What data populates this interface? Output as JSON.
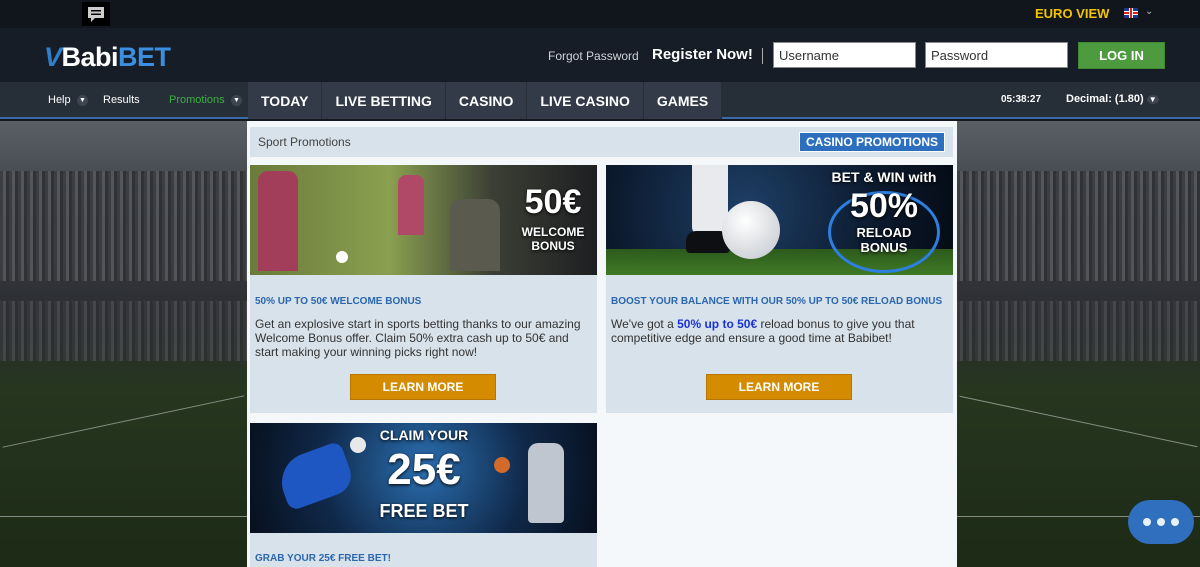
{
  "topbar": {
    "region": "EURO VIEW"
  },
  "header": {
    "logo_prefix": "Babi",
    "logo_suffix": "BET",
    "forgot_password": "Forgot Password",
    "register": "Register Now!",
    "username_placeholder": "Username",
    "password_placeholder": "Password",
    "login": "LOG IN"
  },
  "nav": {
    "help": "Help",
    "results": "Results",
    "promotions": "Promotions",
    "main": [
      "TODAY",
      "LIVE BETTING",
      "CASINO",
      "LIVE CASINO",
      "GAMES"
    ],
    "clock": "05:38:27",
    "odds_format": "Decimal: (1.80)"
  },
  "promotions": {
    "section_title": "Sport Promotions",
    "casino_link": "CASINO PROMOTIONS",
    "cards": [
      {
        "banner_amount": "50€",
        "banner_line1": "WELCOME",
        "banner_line2": "BONUS",
        "title": "50% UP TO 50€ WELCOME BONUS",
        "text": "Get an explosive start in sports betting thanks to our amazing Welcome Bonus offer. Claim 50% extra cash up to 50€ and start making your winning picks right now!",
        "button": "LEARN MORE"
      },
      {
        "banner_top": "BET & WIN with",
        "banner_amount": "50%",
        "banner_line1": "RELOAD",
        "banner_line2": "BONUS",
        "title": "BOOST YOUR BALANCE WITH OUR 50% UP TO 50€ RELOAD BONUS",
        "text_before": "We've got a ",
        "text_highlight": "50% up to 50€",
        "text_after": " reload bonus to give you that competitive edge and ensure a good time at Babibet!",
        "button": "LEARN MORE"
      },
      {
        "banner_top": "CLAIM YOUR",
        "banner_amount": "25€",
        "banner_line1": "FREE BET",
        "title": "GRAB YOUR 25€ FREE BET!"
      }
    ]
  },
  "colors": {
    "accent_yellow": "#f2c400",
    "login_green": "#4d9b3e",
    "promo_blue": "#2c6fbf",
    "learn_more_orange": "#d48b00"
  }
}
